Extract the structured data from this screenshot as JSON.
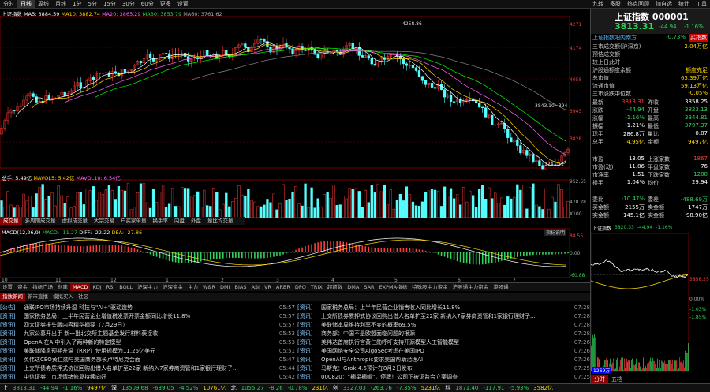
{
  "topbar": {
    "items": [
      "分时",
      "日线",
      "周线",
      "月线",
      "1分",
      "5分",
      "15分",
      "30分",
      "60分",
      "更多",
      "设置"
    ],
    "active": 1,
    "right": [
      "九转",
      "多股",
      "热点回顾",
      "加自选",
      "统计",
      "工具"
    ]
  },
  "chart": {
    "title": "上证指数",
    "ma": {
      "ma5_label": "MA5",
      "ma5": "3884.59",
      "ma10_label": "MA10",
      "ma10": "3882.74",
      "ma20_label": "MA20",
      "ma20": "3865.29",
      "ma30_label": "MA30",
      "ma30": "3853.79",
      "ma60_label": "MA60",
      "ma60": "3761.62"
    },
    "price_ticks": [
      "4271",
      "4174",
      "4058",
      "3943",
      "3828"
    ],
    "high_label": "4258.86",
    "low_label": "3741.11",
    "ref_label": "3843.10~394",
    "vol": {
      "label": "总手",
      "v": "5.49亿",
      "ma5_label": "MAVOL5",
      "ma5": "5.42亿",
      "ma10_label": "MAVOL10",
      "ma10": "6.54亿"
    },
    "vol_ticks": [
      "952.55",
      "478.28",
      "X100"
    ],
    "macd": {
      "label": "MACD(12,26,9)",
      "macd_label": "MACD",
      "macd_v": "-11.27",
      "diff_label": "DIFF",
      "diff": "-22.22",
      "dea_label": "DEA",
      "dea": "-27.86",
      "btn": "指标说明"
    },
    "macd_ticks": [
      "88.55",
      "0.00",
      "-60.88"
    ],
    "date_ticks": [
      "10",
      "11",
      "12",
      "1",
      "2",
      "3",
      "4",
      "5",
      "6",
      "7"
    ]
  },
  "mini_tabs": [
    "成交量",
    "多周期成交量",
    "虚拟成交量",
    "大宗交易",
    "户买家单量",
    "换手率",
    "内盘",
    "外盘",
    "量比均交量"
  ],
  "indicator_tabs": [
    "设置",
    "资金",
    "指标广场",
    "创建",
    "MACD",
    "KDJ",
    "RSI",
    "BOLL",
    "沪深主力",
    "沪深资金",
    "主力",
    "W&R",
    "DMI",
    "BIAS",
    "ASI",
    "VR",
    "ARBR",
    "DPO",
    "TRIX",
    "超前数",
    "DMA",
    "SAR",
    "EXPMA指标",
    "特殊股主力资金",
    "沪股通主力资金",
    "港股通"
  ],
  "news_tabs": [
    "指数新闻",
    "新市直播",
    "模拟买入",
    "社区"
  ],
  "news_left": [
    {
      "tag": "[公告]",
      "text": "通联IPO市场持续升温 科技与\"AI+\"驱动造势",
      "time": "05:57"
    },
    {
      "tag": "[资讯]",
      "text": "国家税务总局：上半年民营企业增值税发票开票金额同比增长11.8%",
      "time": "05:57"
    },
    {
      "tag": "[资讯]",
      "text": "四大证券报头版内容精华摘要（7月29日）",
      "time": "05:57"
    },
    {
      "tag": "[资讯]",
      "text": "九家公募开出手 新一批北交所主题基金发行材料获接收",
      "time": "05:53"
    },
    {
      "tag": "[资讯]",
      "text": "OpenAI在AI中引入了两种新的特定模型",
      "time": "05:53"
    },
    {
      "tag": "[资讯]",
      "text": "美联储降息预期升温（RRP）使用规模为11.26亿美元",
      "time": "05:51"
    },
    {
      "tag": "[资讯]",
      "text": "英伟达CEO黄仁勋与美国商务部长卢特尼克会面",
      "time": "05:47"
    },
    {
      "tag": "[资讯]",
      "text": "上交所债券质押式协议回购出借人名单扩至22家 新纳入7家券商资管和1家银行理财子...",
      "time": "05:44"
    },
    {
      "tag": "[资讯]",
      "text": "中信证券：市场情绪修复持续向好",
      "time": "05:42"
    }
  ],
  "news_right": [
    {
      "tag": "[资讯]",
      "text": "国家税务总局：上半年民营企业销售收入同比增长11.8%",
      "time": "07:28"
    },
    {
      "tag": "[资讯]",
      "text": "上交所债券质押式协议回购出借人名单扩至22家 新纳入7家券商资管和1家银行理财子...",
      "time": "07:28"
    },
    {
      "tag": "[资讯]",
      "text": "美联储本周维持利率不变的概率69.5%",
      "time": "07:28"
    },
    {
      "tag": "[资讯]",
      "text": "商务部：中国不是欧盟面临问题的根源",
      "time": "07:28"
    },
    {
      "tag": "[资讯]",
      "text": "美伟达首席执行官黄仁勋呼吁支持开源模型人工智能模型",
      "time": "07:26"
    },
    {
      "tag": "[资讯]",
      "text": "美国网络安全公司AlgoSec考虑在美国IPO",
      "time": "07:26"
    },
    {
      "tag": "[资讯]",
      "text": "OpenAI与Anthropic要求美国帮助治理AI",
      "time": "07:26"
    },
    {
      "tag": "[资讯]",
      "text": "马斯克：Grok 4.6预计在8月2日发布",
      "time": "07:25"
    },
    {
      "tag": "[资讯]",
      "text": "000820：\"摘星摘帽\"，停牌！公司正被证监会立案调查",
      "time": "07:25"
    }
  ],
  "right_panel": {
    "name": "上证指数",
    "code": "000001",
    "price": "3813.31",
    "change": "-44.94",
    "pct": "-1.16%",
    "sub_link": "上证指数吧内南方",
    "sub_pct": "-0.73%",
    "sub_btn": "买指数",
    "info_rows": [
      {
        "l": "三市成交额(沪深京)",
        "v": "2.04万亿"
      },
      {
        "l": "预估成交额",
        "v": ""
      },
      {
        "l": "较上日此时",
        "v": ""
      },
      {
        "l": "沪股通额度余额",
        "v": "额度充足"
      },
      {
        "l": "总市值",
        "v": "63.39万亿"
      },
      {
        "l": "流通市值",
        "v": "59.13万亿"
      },
      {
        "l": "三市涨跌中位数",
        "v": "-0.05%"
      }
    ],
    "quote_rows": [
      {
        "l": "最新",
        "v": "3813.31",
        "l2": "昨收",
        "v2": "3858.25",
        "c1": "red",
        "c2": "white"
      },
      {
        "l": "涨跌",
        "v": "-44.94",
        "l2": "开盘",
        "v2": "3823.13",
        "c1": "green",
        "c2": "green"
      },
      {
        "l": "涨幅",
        "v": "-1.16%",
        "l2": "最高",
        "v2": "3844.81",
        "c1": "green",
        "c2": "green"
      },
      {
        "l": "振幅",
        "v": "1.21%",
        "l2": "最低",
        "v2": "3797.37",
        "c1": "white",
        "c2": "green"
      },
      {
        "l": "现手",
        "v": "286.8万",
        "l2": "量比",
        "v2": "0.87",
        "c1": "white",
        "c2": "white"
      },
      {
        "l": "总手",
        "v": "4.95亿",
        "l2": "金额",
        "v2": "9497亿",
        "c1": "yellow",
        "c2": "yellow"
      }
    ],
    "stat_rows": [
      {
        "l": "市盈",
        "v": "13.05",
        "l2": "上涨家数",
        "v2": "1867",
        "c2": "red"
      },
      {
        "l": "市盈(动)",
        "v": "11.86",
        "l2": "平盘家数",
        "v2": "76",
        "c2": "white"
      },
      {
        "l": "市净率",
        "v": "1.51",
        "l2": "下跌家数",
        "v2": "1208",
        "c2": "green"
      },
      {
        "l": "换手",
        "v": "1.04%",
        "l2": "均价",
        "v2": "29.94",
        "c2": "white"
      }
    ],
    "flow_rows": [
      {
        "l": "委比",
        "v": "-10.47%",
        "l2": "委差",
        "v2": "-488.69万"
      },
      {
        "l": "买金额",
        "v": "2155万",
        "l2": "卖金额",
        "v2": "1747万"
      },
      {
        "l": "实金额",
        "v": "145.1亿",
        "l2": "实金额",
        "v2": "98.90亿"
      }
    ],
    "mini_chart": {
      "title": "上证指数",
      "v1": "3820.33",
      "v2": "-44.94",
      "v3": "-1.16%",
      "ticks": [
        "3858.25",
        "0.00%",
        "-1.03%",
        "-1.85%"
      ],
      "low": "3797.37",
      "vol_label": "1269万"
    },
    "tabs": [
      "分时",
      "五档"
    ]
  },
  "status": [
    {
      "t": "上",
      "c": "white"
    },
    {
      "t": "3813.31",
      "c": "green"
    },
    {
      "t": "-44.94",
      "c": "green"
    },
    {
      "t": "-1.16%",
      "c": "green"
    },
    {
      "t": "9497亿",
      "c": "yellow"
    },
    {
      "t": "深",
      "c": "white"
    },
    {
      "t": "13509.68",
      "c": "green"
    },
    {
      "t": "-639.05",
      "c": "green"
    },
    {
      "t": "-4.52%",
      "c": "green"
    },
    {
      "t": "10761亿",
      "c": "yellow"
    },
    {
      "t": "北",
      "c": "white"
    },
    {
      "t": "1055.27",
      "c": "green"
    },
    {
      "t": "-8.26",
      "c": "green"
    },
    {
      "t": "-0.78%",
      "c": "green"
    },
    {
      "t": "231亿",
      "c": "yellow"
    },
    {
      "t": "创",
      "c": "white"
    },
    {
      "t": "3327.03",
      "c": "green"
    },
    {
      "t": "-263.76",
      "c": "green"
    },
    {
      "t": "-7.35%",
      "c": "green"
    },
    {
      "t": "5231亿",
      "c": "yellow"
    },
    {
      "t": "科",
      "c": "white"
    },
    {
      "t": "1871.40",
      "c": "green"
    },
    {
      "t": "-117.91",
      "c": "green"
    },
    {
      "t": "-5.93%",
      "c": "green"
    },
    {
      "t": "3582亿",
      "c": "yellow"
    }
  ],
  "colors": {
    "up": "#ff3b3b",
    "down": "#2fd45a",
    "ma5": "#ffffff",
    "ma10": "#ffd700",
    "ma20": "#ff66ff",
    "ma30": "#00ff00",
    "ma60": "#888888",
    "vol_up": "#ff3b3b",
    "vol_down": "#5ff"
  }
}
